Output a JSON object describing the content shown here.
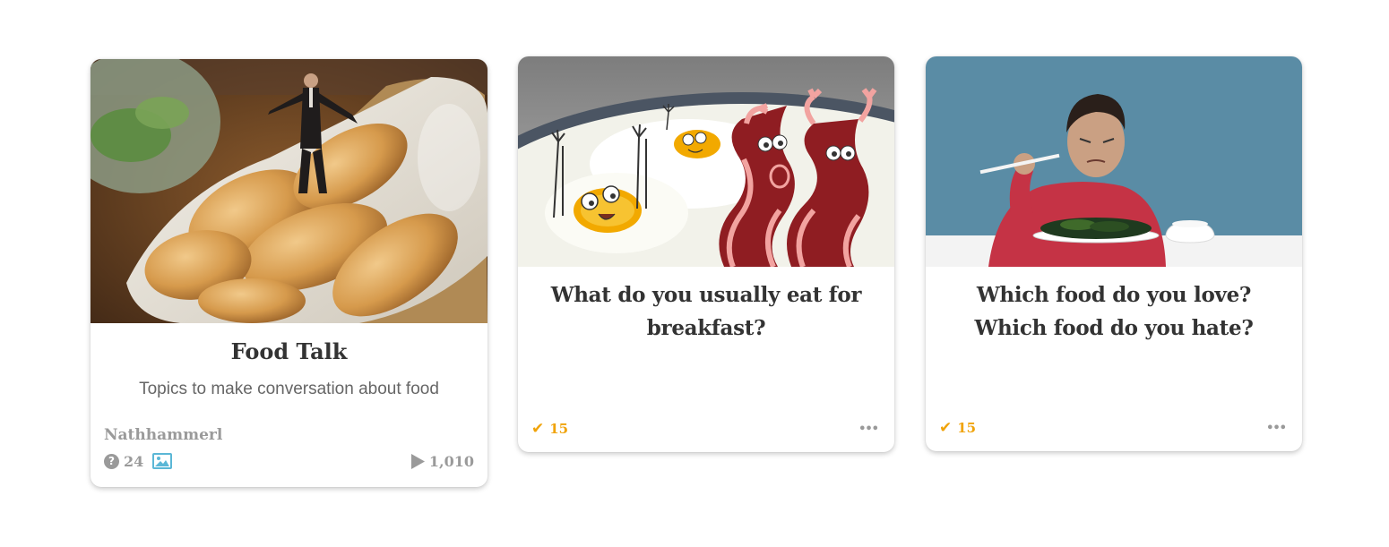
{
  "cards": [
    {
      "title": "Food Talk",
      "description": "Topics to make conversation about food",
      "author": "Nathhammerl",
      "question_count": "24",
      "play_count": "1,010",
      "icons": [
        "question-icon",
        "image-icon",
        "play-icon"
      ],
      "image_subject": "breadsticks"
    },
    {
      "title": "What do you usually eat for breakfast?",
      "votes": "15",
      "more_label": "•••",
      "icons": [
        "check-icon",
        "more-icon"
      ],
      "image_subject": "eggs-and-bacon-cartoon"
    },
    {
      "title": "Which food do you love? Which food do you hate?",
      "votes": "15",
      "more_label": "•••",
      "icons": [
        "check-icon",
        "more-icon"
      ],
      "image_subject": "kid-eating"
    }
  ],
  "colors": {
    "accent": "#f0a30a",
    "muted": "#9a9a9a",
    "title": "#333333",
    "image_icon": "#5bb7d6"
  }
}
